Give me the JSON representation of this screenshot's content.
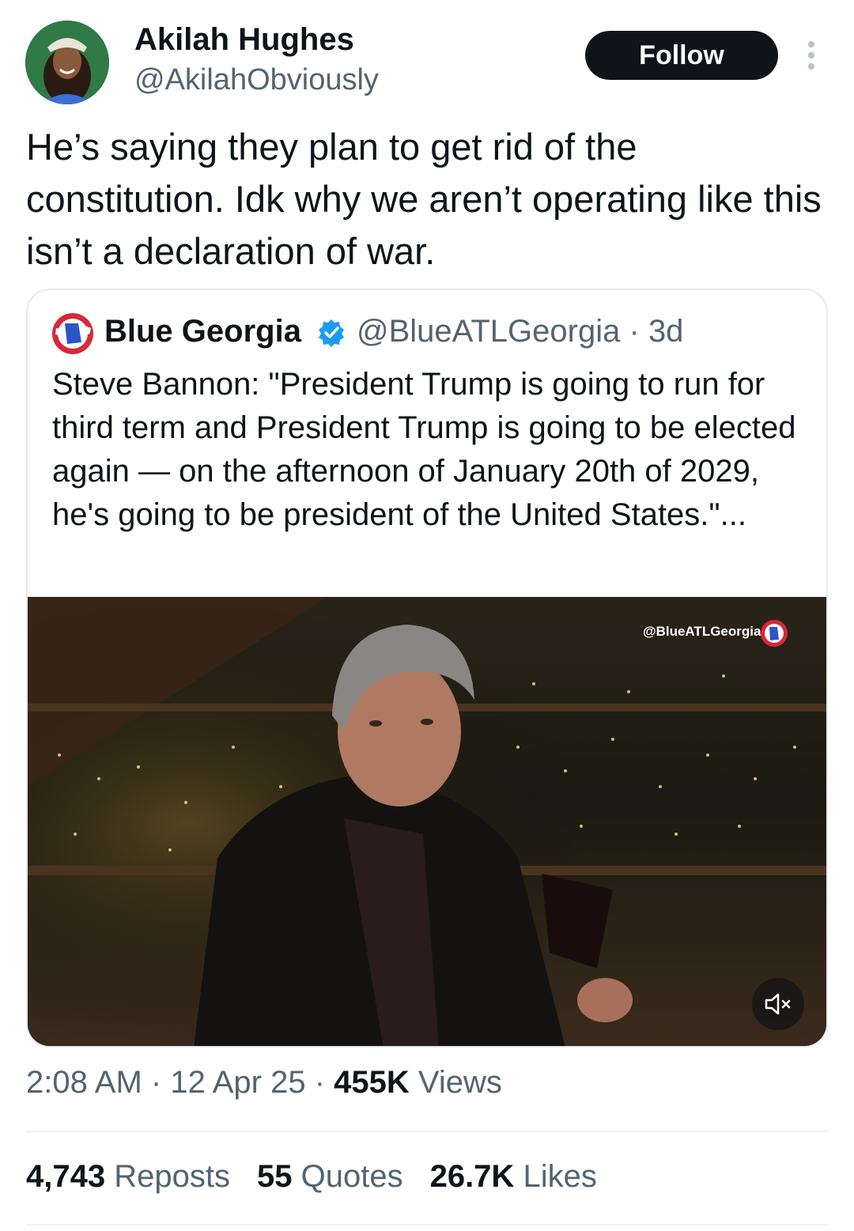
{
  "author": {
    "display_name": "Akilah Hughes",
    "handle": "@AkilahObviously",
    "avatar_icon": "profile-photo"
  },
  "follow_label": "Follow",
  "more_icon": "more-vertical-icon",
  "tweet": {
    "text": "He’s saying they plan to get rid of the constitution. Idk why we aren’t operating like this isn’t a declaration of war."
  },
  "quoted": {
    "name": "Blue Georgia",
    "handle": "@BlueATLGeorgia",
    "separator": "·",
    "age": "3d",
    "text": "Steve Bannon: \"President Trump is going to run for third term and President Trump is going to be elected again — on the afternoon of January 20th of 2029, he's going to be president of the United States.\"...",
    "watermark": "@BlueATLGeorgia",
    "verified_color": "#1d9bf0"
  },
  "meta": {
    "time": "2:08 AM",
    "date": "12 Apr 25",
    "views_count": "455K",
    "views_label": "Views"
  },
  "stats": [
    {
      "count": "4,743",
      "label": "Reposts"
    },
    {
      "count": "55",
      "label": "Quotes"
    },
    {
      "count": "26.7K",
      "label": "Likes"
    }
  ],
  "colors": {
    "text": "#0f1419",
    "secondary": "#536471",
    "button_bg": "#0f1419",
    "verified": "#1d9bf0"
  }
}
